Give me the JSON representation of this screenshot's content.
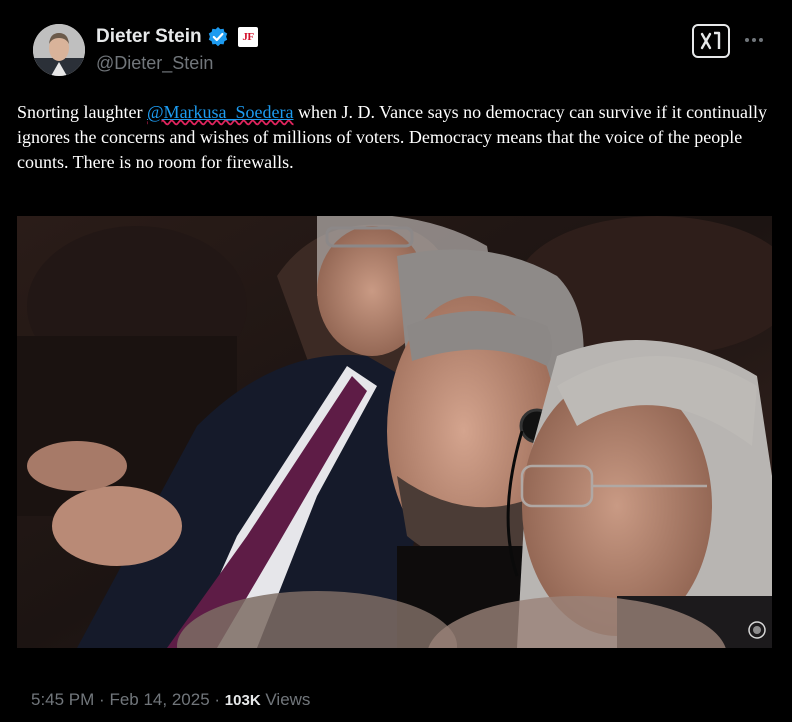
{
  "author": {
    "display_name": "Dieter Stein",
    "handle": "@Dieter_Stein",
    "verified": true,
    "affiliate_badge": "JF",
    "verified_color": "#1d9bf0",
    "affiliate_color": "#d4112b"
  },
  "tweet": {
    "text_before": "Snorting laughter ",
    "mention": "@Markusa_Soedera",
    "text_after": " when J. D. Vance says no democracy can survive if it continually ignores the concerns and wishes of millions of voters. Democracy means that the voice of the people counts. There is no room for firewalls."
  },
  "actions": {
    "grok_icon": "grok-icon",
    "more_icon": "more-options-icon"
  },
  "meta": {
    "time": "5:45 PM",
    "date": "Feb 14, 2025",
    "separator": "·",
    "views_count": "103K",
    "views_label": "Views"
  },
  "colors": {
    "background": "#000000",
    "text": "#e7e9ea",
    "secondary": "#71767b",
    "link": "#1d9bf0"
  }
}
